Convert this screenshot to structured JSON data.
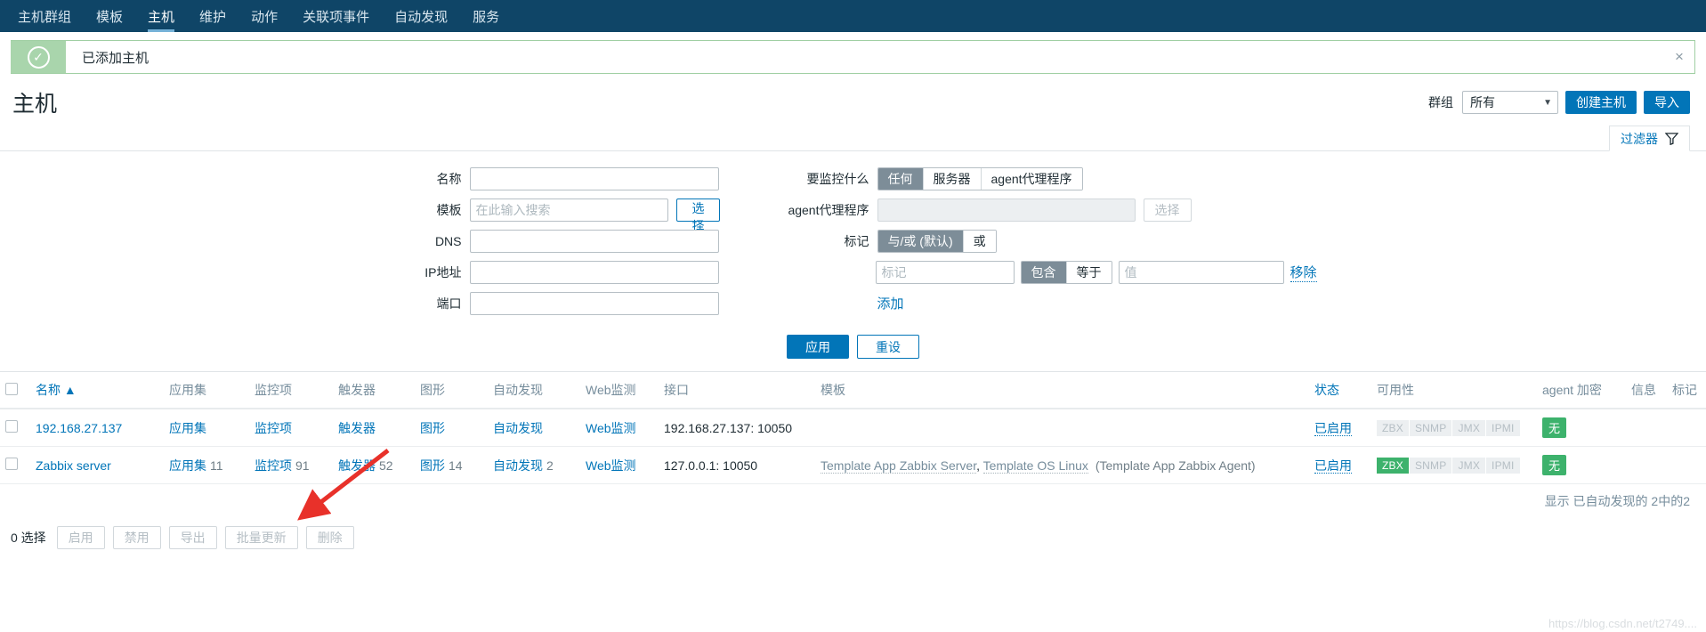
{
  "nav": {
    "items": [
      {
        "label": "主机群组",
        "active": false
      },
      {
        "label": "模板",
        "active": false
      },
      {
        "label": "主机",
        "active": true
      },
      {
        "label": "维护",
        "active": false
      },
      {
        "label": "动作",
        "active": false
      },
      {
        "label": "关联项事件",
        "active": false
      },
      {
        "label": "自动发现",
        "active": false
      },
      {
        "label": "服务",
        "active": false
      }
    ]
  },
  "message": {
    "text": "已添加主机",
    "icon": "check-circle-icon",
    "close": "×",
    "accent": "#a9d5ac"
  },
  "header": {
    "title": "主机",
    "group_label": "群组",
    "group_value": "所有",
    "create_host_label": "创建主机",
    "import_label": "导入"
  },
  "filter_tab": {
    "label": "过滤器",
    "icon": "funnel-icon"
  },
  "filter": {
    "left": [
      {
        "label": "名称",
        "value": "",
        "placeholder": "",
        "type": "text"
      },
      {
        "label": "模板",
        "value": "",
        "placeholder": "在此输入搜索",
        "type": "text",
        "button": "选择"
      },
      {
        "label": "DNS",
        "value": "",
        "placeholder": "",
        "type": "text"
      },
      {
        "label": "IP地址",
        "value": "",
        "placeholder": "",
        "type": "text"
      },
      {
        "label": "端口",
        "value": "",
        "placeholder": "",
        "type": "text"
      }
    ],
    "monitored_by": {
      "label": "要监控什么",
      "options": [
        "任何",
        "服务器",
        "agent代理程序"
      ],
      "selected": "任何"
    },
    "proxy": {
      "label": "agent代理程序",
      "value": "",
      "placeholder": "",
      "button": "选择",
      "disabled": true
    },
    "tags_mode": {
      "label": "标记",
      "options": [
        "与/或 (默认)",
        "或"
      ],
      "selected": "与/或 (默认)"
    },
    "tag_row": {
      "tag_placeholder": "标记",
      "tag_value": "",
      "operators": [
        "包含",
        "等于"
      ],
      "operator_selected": "包含",
      "value_placeholder": "值",
      "value_value": "",
      "remove_label": "移除"
    },
    "add_label": "添加",
    "apply_label": "应用",
    "reset_label": "重设"
  },
  "table": {
    "columns": [
      "名称 ▲",
      "应用集",
      "监控项",
      "触发器",
      "图形",
      "自动发现",
      "Web监测",
      "接口",
      "模板",
      "状态",
      "可用性",
      "agent 加密",
      "信息",
      "标记"
    ],
    "rows": [
      {
        "name": "192.168.27.137",
        "applications": {
          "label": "应用集",
          "count": ""
        },
        "items": {
          "label": "监控项",
          "count": ""
        },
        "triggers": {
          "label": "触发器",
          "count": ""
        },
        "graphs": {
          "label": "图形",
          "count": ""
        },
        "discovery": {
          "label": "自动发现",
          "count": ""
        },
        "web": {
          "label": "Web监测",
          "count": ""
        },
        "interface": "192.168.27.137: 10050",
        "templates": [],
        "templates_suffix": "",
        "status": "已启用",
        "availability": [
          {
            "label": "ZBX",
            "active": false
          },
          {
            "label": "SNMP",
            "active": false
          },
          {
            "label": "JMX",
            "active": false
          },
          {
            "label": "IPMI",
            "active": false
          }
        ],
        "encryption": "无",
        "info": "",
        "tags": ""
      },
      {
        "name": "Zabbix server",
        "applications": {
          "label": "应用集",
          "count": "11"
        },
        "items": {
          "label": "监控项",
          "count": "91"
        },
        "triggers": {
          "label": "触发器",
          "count": "52"
        },
        "graphs": {
          "label": "图形",
          "count": "14"
        },
        "discovery": {
          "label": "自动发现",
          "count": "2"
        },
        "web": {
          "label": "Web监测",
          "count": ""
        },
        "interface": "127.0.0.1: 10050",
        "templates": [
          "Template App Zabbix Server",
          "Template OS Linux"
        ],
        "templates_suffix": " (Template App Zabbix Agent)",
        "status": "已启用",
        "availability": [
          {
            "label": "ZBX",
            "active": true
          },
          {
            "label": "SNMP",
            "active": false
          },
          {
            "label": "JMX",
            "active": false
          },
          {
            "label": "IPMI",
            "active": false
          }
        ],
        "encryption": "无",
        "info": "",
        "tags": ""
      }
    ],
    "footer_text": "显示 已自动发现的 2中的2"
  },
  "footer": {
    "selected_text": "0 选择",
    "buttons": [
      "启用",
      "禁用",
      "导出",
      "批量更新",
      "删除"
    ]
  },
  "annotation": {
    "type": "red-arrow",
    "target": "监控项",
    "color": "#e8312a"
  },
  "watermark": "https://blog.csdn.net/t2749...."
}
